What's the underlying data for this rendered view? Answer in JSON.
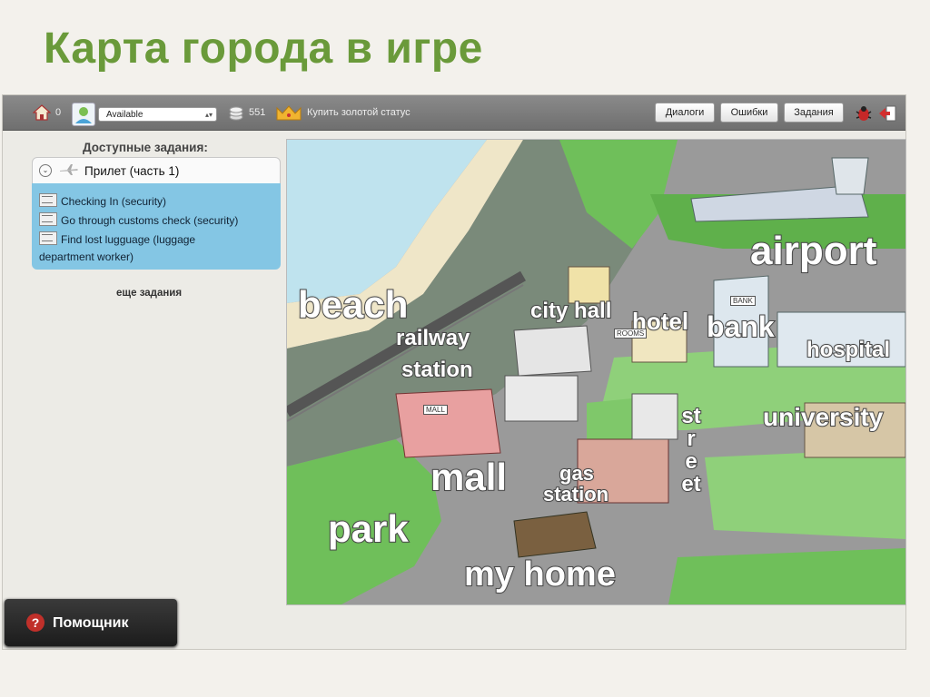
{
  "slide": {
    "title": "Карта города в игре"
  },
  "topbar": {
    "home_count": "0",
    "status_value": "Available",
    "coins": "551",
    "gold_status": "Купить золотой статус",
    "buttons": {
      "dialogs": "Диалоги",
      "errors": "Ошибки",
      "tasks": "Задания"
    }
  },
  "sidebar": {
    "title": "Доступные задания:",
    "quest_title": "Прилет (часть 1)",
    "tasks": [
      "Checking In (security)",
      "Go through customs check (security)",
      "Find lost lugguage (luggage",
      "department worker)"
    ],
    "more": "еще задания"
  },
  "map": {
    "labels": {
      "airport": "airport",
      "beach": "beach",
      "city_hall": "city hall",
      "hotel": "hotel",
      "bank": "bank",
      "hospital": "hospital",
      "railway": "railway",
      "station": "station",
      "university": "university",
      "mall": "mall",
      "gas": "gas",
      "gas_station": "station",
      "street": "street",
      "park": "park",
      "my_home": "my home",
      "sign_bank": "BANK",
      "sign_mall": "MALL",
      "sign_rooms": "ROOMS"
    }
  },
  "helper": {
    "label": "Помощник"
  },
  "colors": {
    "title_green": "#6a9a3a",
    "panel_blue": "#84c6e4",
    "grass": "#6fbf5a"
  }
}
